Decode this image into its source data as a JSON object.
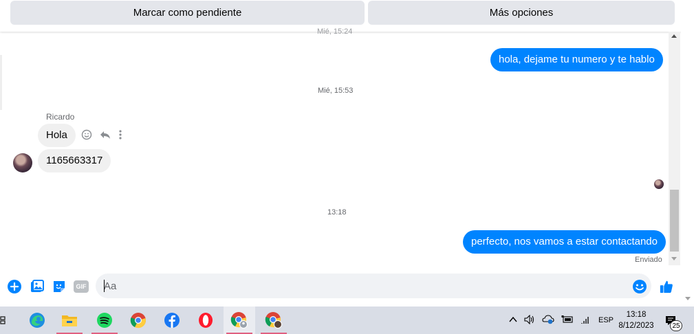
{
  "topbar": {
    "mark_pending_label": "Marcar como pendiente",
    "more_options_label": "Más opciones"
  },
  "chat": {
    "cut_timestamp": "Mié, 15:24",
    "messages": [
      {
        "direction": "outgoing",
        "text": "hola, dejame tu numero y te hablo"
      },
      {
        "direction": "timestamp",
        "text": "Mié, 15:53"
      },
      {
        "direction": "incoming",
        "sender": "Ricardo",
        "text": "Hola"
      },
      {
        "direction": "incoming",
        "text": "1165663317"
      },
      {
        "direction": "timestamp",
        "text": "13:18"
      },
      {
        "direction": "outgoing",
        "text": "perfecto, nos vamos a estar contactando"
      }
    ],
    "sent_status": "Enviado"
  },
  "composer": {
    "placeholder": "Aa",
    "icons": [
      "plus-icon",
      "photo-icon",
      "sticker-icon",
      "gif-icon",
      "emoji-icon",
      "like-icon"
    ],
    "gif_label": "GIF"
  },
  "taskbar": {
    "apps": [
      "task-view",
      "edge",
      "file-explorer",
      "spotify",
      "chrome",
      "facebook",
      "opera",
      "chrome-profile-1",
      "chrome-profile-2"
    ],
    "language": "ESP",
    "time": "13:18",
    "date": "8/12/2023",
    "notification_count": "25"
  },
  "colors": {
    "accent": "#0084ff",
    "incoming_bubble": "#f0f0f0",
    "button_bg": "#e4e6eb"
  }
}
